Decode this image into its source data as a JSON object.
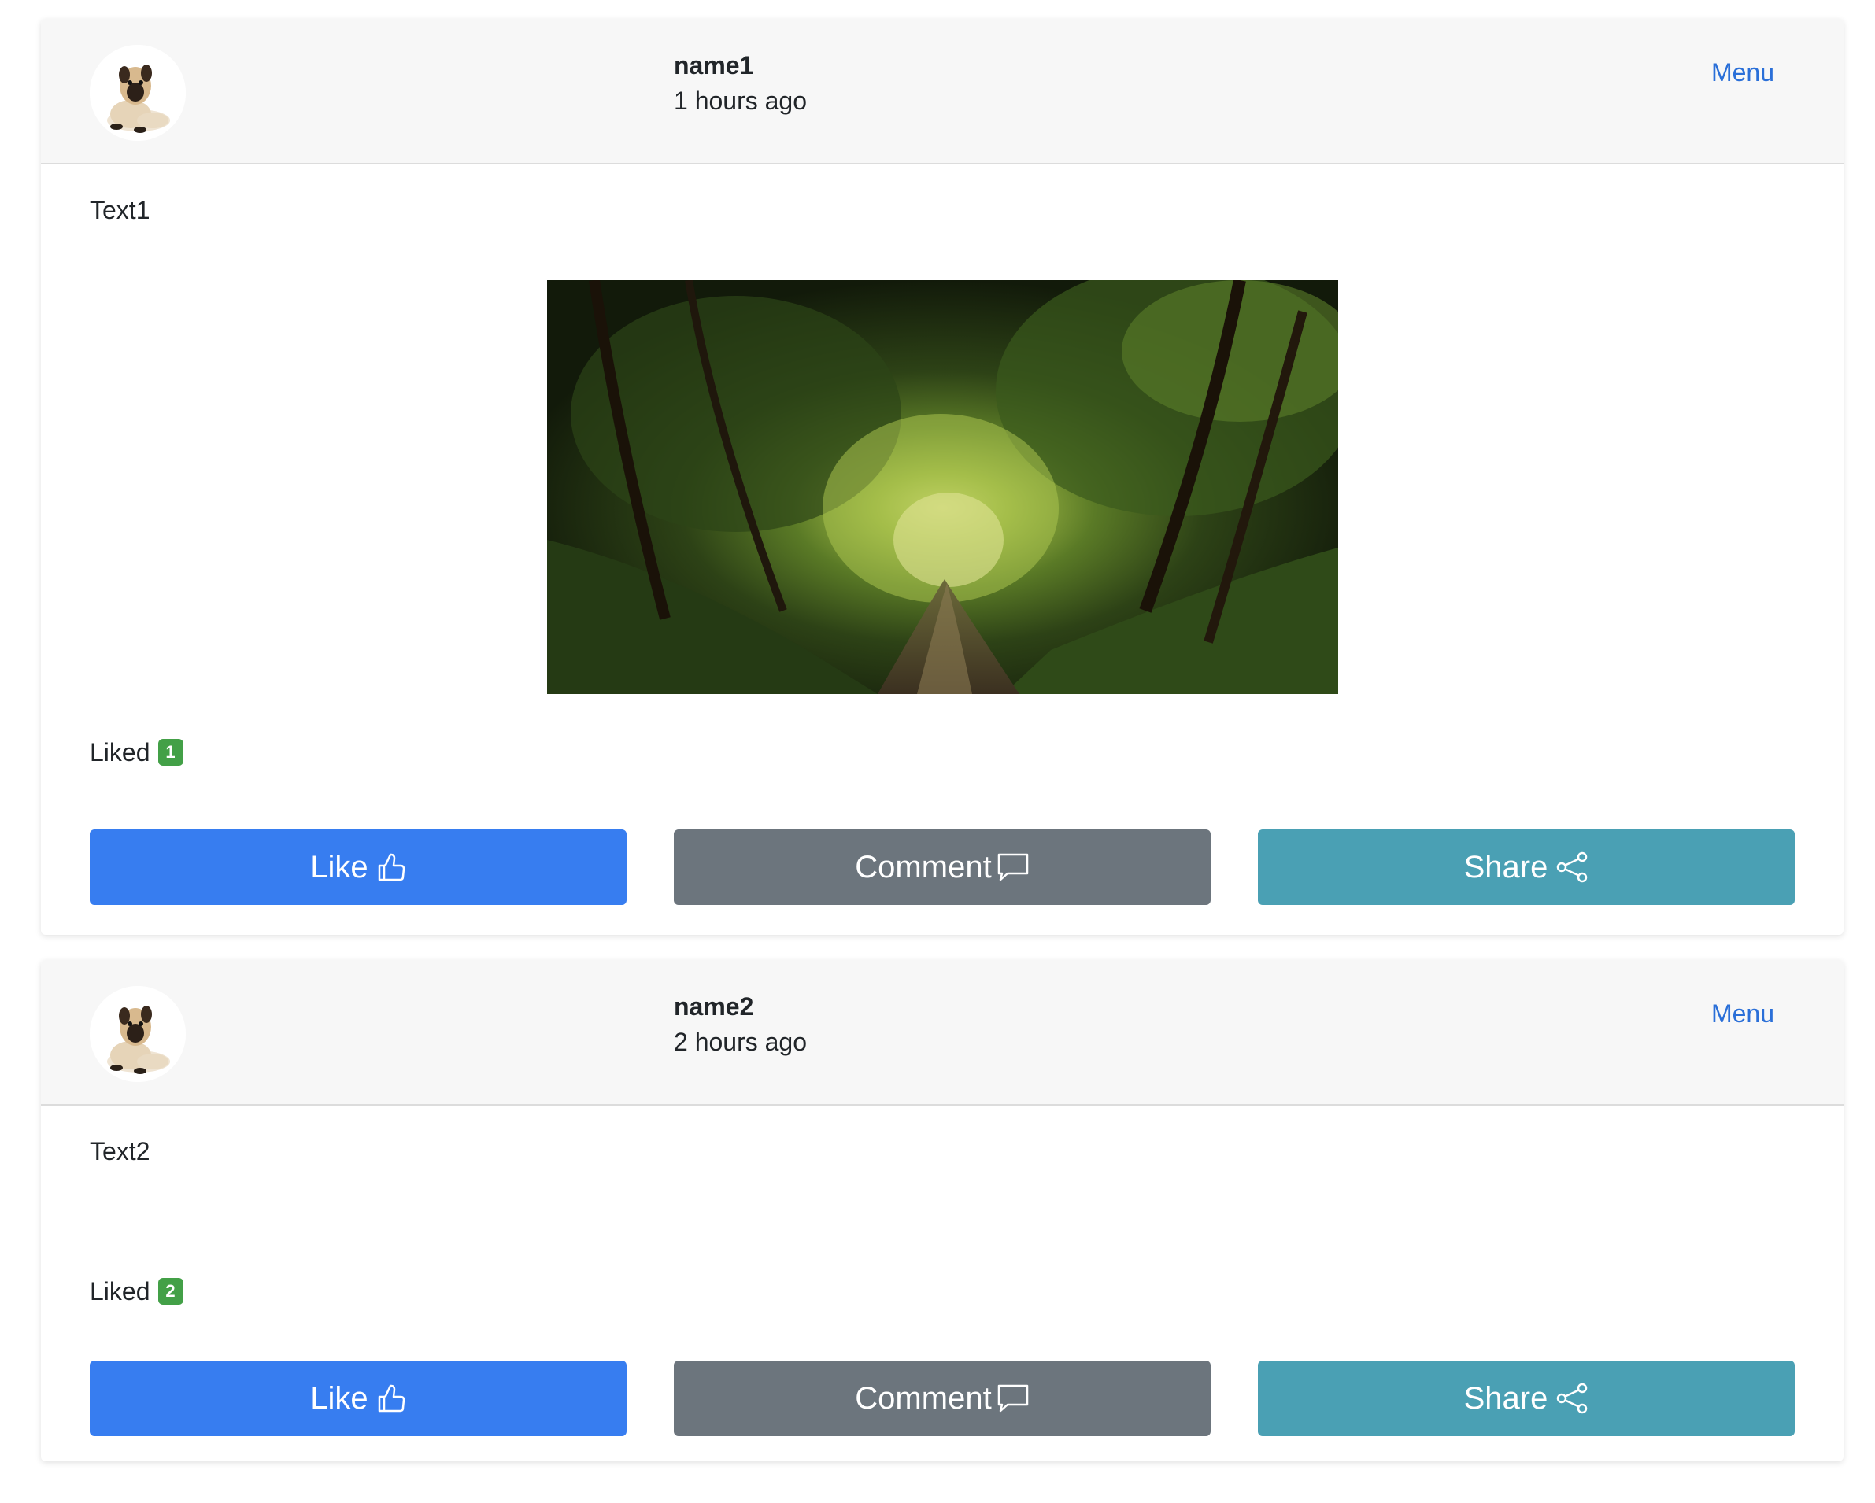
{
  "posts": [
    {
      "author": "name1",
      "time": "1 hours ago",
      "menu_label": "Menu",
      "text": "Text1",
      "has_image": true,
      "image_description_icon": "forest-tunnel-photo",
      "liked_label": "Liked",
      "liked_count": "1",
      "buttons": {
        "like": "Like",
        "comment": "Comment",
        "share": "Share"
      }
    },
    {
      "author": "name2",
      "time": "2 hours ago",
      "menu_label": "Menu",
      "text": "Text2",
      "has_image": false,
      "liked_label": "Liked",
      "liked_count": "2",
      "buttons": {
        "like": "Like",
        "comment": "Comment",
        "share": "Share"
      }
    }
  ],
  "icons": {
    "like": "thumbs-up-icon",
    "comment": "speech-bubble-icon",
    "share": "share-nodes-icon",
    "avatar": "pug-puppy-avatar"
  },
  "colors": {
    "like_button": "#377df0",
    "comment_button": "#6c757d",
    "share_button": "#4aa0b4",
    "badge": "#43a047",
    "menu_link": "#2a6fd8",
    "header_bg": "#f7f7f7"
  }
}
